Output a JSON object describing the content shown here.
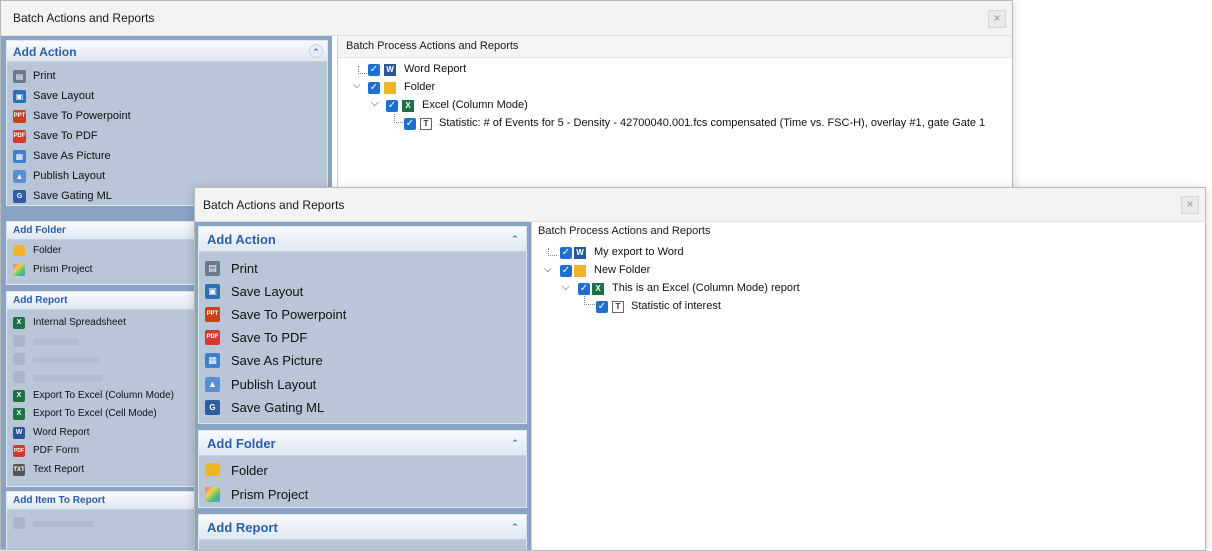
{
  "back": {
    "title": "Batch Actions and Reports",
    "close": "×",
    "right_header": "Batch Process Actions and Reports",
    "add_action": {
      "header": "Add Action",
      "chevron": "⌃",
      "items": [
        {
          "label": "Print",
          "icon": "print-icon"
        },
        {
          "label": "Save Layout",
          "icon": "save-icon"
        },
        {
          "label": "Save To Powerpoint",
          "icon": "powerpoint-icon"
        },
        {
          "label": "Save To PDF",
          "icon": "pdf-icon"
        },
        {
          "label": "Save As Picture",
          "icon": "picture-icon"
        },
        {
          "label": "Publish Layout",
          "icon": "publish-icon"
        },
        {
          "label": "Save Gating ML",
          "icon": "gating-ml-icon"
        }
      ]
    },
    "add_folder": {
      "header": "Add Folder",
      "items": [
        {
          "label": "Folder",
          "icon": "folder-icon"
        },
        {
          "label": "Prism Project",
          "icon": "prism-icon"
        }
      ]
    },
    "add_report": {
      "header": "Add Report",
      "items": [
        {
          "label": "Internal Spreadsheet",
          "icon": "spreadsheet-icon"
        },
        {
          "label": "Export To Excel (Column Mode)",
          "icon": "excel-icon"
        },
        {
          "label": "Export To Excel (Cell Mode)",
          "icon": "excel-icon"
        },
        {
          "label": "Word Report",
          "icon": "word-icon"
        },
        {
          "label": "PDF Form",
          "icon": "pdf-form-icon"
        },
        {
          "label": "Text Report",
          "icon": "text-report-icon"
        }
      ]
    },
    "add_item": {
      "header": "Add Item To Report"
    },
    "tree": [
      {
        "label": "Word Report"
      },
      {
        "label": "Folder"
      },
      {
        "label": "Excel (Column Mode)"
      },
      {
        "label": "Statistic: # of Events for 5 - Density - 42700040.001.fcs compensated (Time vs. FSC-H), overlay #1, gate Gate 1"
      }
    ]
  },
  "front": {
    "title": "Batch Actions and Reports",
    "close": "×",
    "right_header": "Batch Process Actions and Reports",
    "add_action": {
      "header": "Add Action",
      "chevron": "⌃",
      "items": [
        {
          "label": "Print",
          "icon": "print-icon"
        },
        {
          "label": "Save Layout",
          "icon": "save-icon"
        },
        {
          "label": "Save To Powerpoint",
          "icon": "powerpoint-icon"
        },
        {
          "label": "Save To PDF",
          "icon": "pdf-icon"
        },
        {
          "label": "Save As Picture",
          "icon": "picture-icon"
        },
        {
          "label": "Publish Layout",
          "icon": "publish-icon"
        },
        {
          "label": "Save Gating ML",
          "icon": "gating-ml-icon"
        }
      ]
    },
    "add_folder": {
      "header": "Add Folder",
      "chevron": "⌃",
      "items": [
        {
          "label": "Folder",
          "icon": "folder-icon"
        },
        {
          "label": "Prism Project",
          "icon": "prism-icon"
        }
      ]
    },
    "add_report": {
      "header": "Add Report",
      "chevron": "⌃"
    },
    "tree": [
      {
        "label": "My export to Word"
      },
      {
        "label": "New Folder"
      },
      {
        "label": "This is an Excel (Column Mode) report"
      },
      {
        "label": "Statistic of interest"
      }
    ]
  },
  "glyphs": {
    "check": "✓",
    "expanded": "⌵"
  },
  "colors": {
    "sidebar_bg": "#8aa3c4",
    "section_header_text": "#2c5ea8",
    "checkbox": "#1f6fd0"
  }
}
